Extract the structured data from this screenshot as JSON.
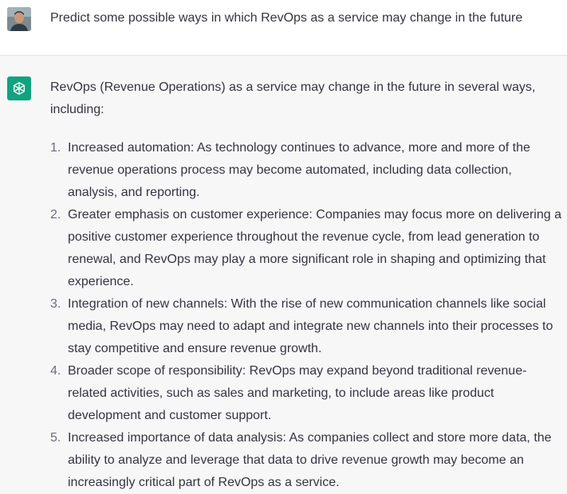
{
  "user": {
    "avatar_icon": "user-photo-avatar",
    "prompt": "Predict some possible ways in which RevOps as a service may change in the future"
  },
  "assistant": {
    "avatar_icon": "chatgpt-logo-icon",
    "accent": "#10a37f",
    "intro": "RevOps (Revenue Operations) as a service may change in the future in several ways, including:",
    "items": [
      {
        "num": "1.",
        "text": "Increased automation: As technology continues to advance, more and more of the revenue operations process may become automated, including data collection, analysis, and reporting."
      },
      {
        "num": "2.",
        "text": "Greater emphasis on customer experience: Companies may focus more on delivering a positive customer experience throughout the revenue cycle, from lead generation to renewal, and RevOps may play a more significant role in shaping and optimizing that experience."
      },
      {
        "num": "3.",
        "text": "Integration of new channels: With the rise of new communication channels like social media, RevOps may need to adapt and integrate new channels into their processes to stay competitive and ensure revenue growth."
      },
      {
        "num": "4.",
        "text": "Broader scope of responsibility: RevOps may expand beyond traditional revenue-related activities, such as sales and marketing, to include areas like product development and customer support."
      },
      {
        "num": "5.",
        "text": "Increased importance of data analysis: As companies collect and store more data, the ability to analyze and leverage that data to drive revenue growth may become an increasingly critical part of RevOps as a service."
      }
    ]
  }
}
